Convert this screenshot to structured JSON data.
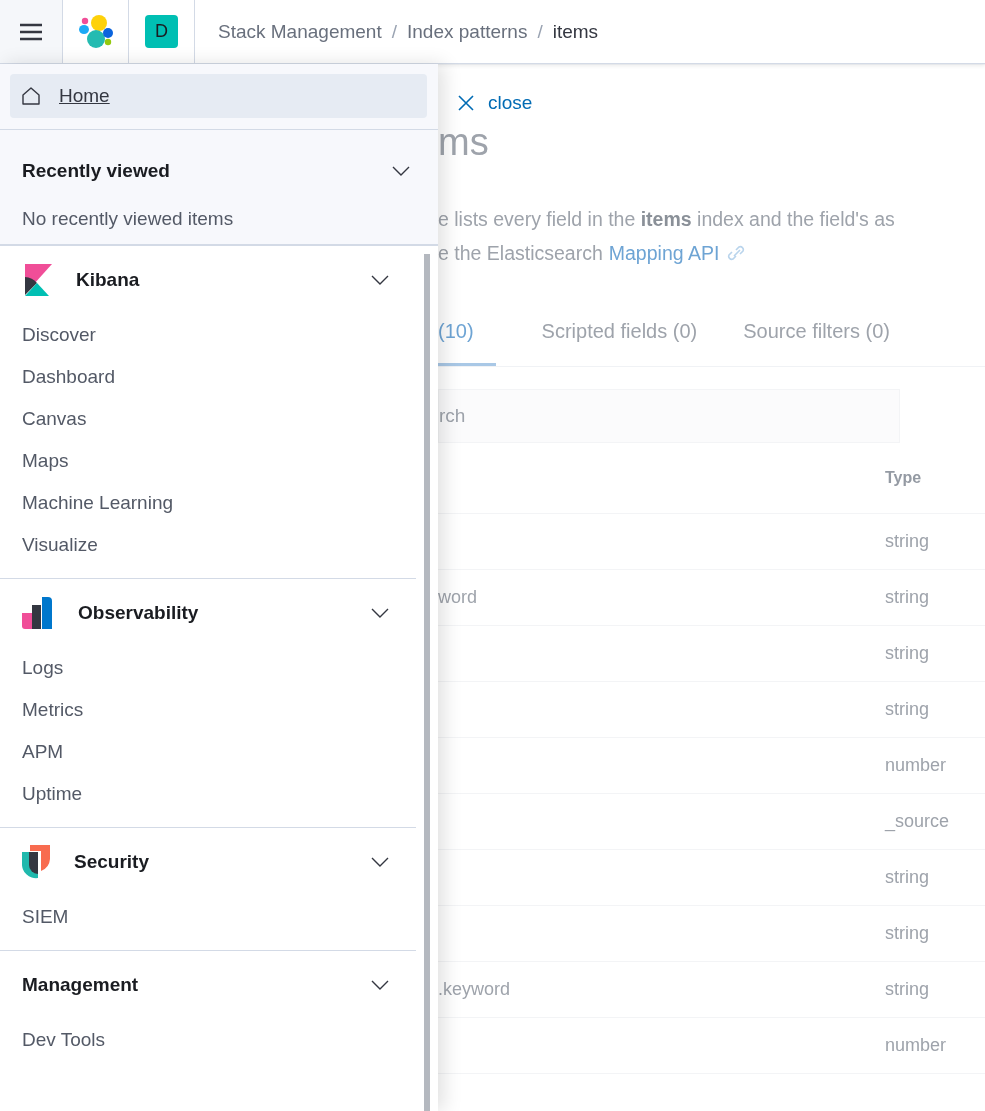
{
  "header": {
    "avatar": "D",
    "separator": "/",
    "breadcrumbs": [
      {
        "label": "Stack Management",
        "current": false
      },
      {
        "label": "Index patterns",
        "current": false
      },
      {
        "label": "items",
        "current": true
      }
    ]
  },
  "nav": {
    "home": {
      "label": "Home",
      "selected": true
    },
    "recently_viewed": {
      "title": "Recently viewed",
      "expanded": true,
      "empty_text": "No recently viewed items"
    },
    "groups": [
      {
        "title": "Kibana",
        "expanded": true,
        "items": [
          "Discover",
          "Dashboard",
          "Canvas",
          "Maps",
          "Machine Learning",
          "Visualize"
        ]
      },
      {
        "title": "Observability",
        "expanded": true,
        "items": [
          "Logs",
          "Metrics",
          "APM",
          "Uptime"
        ]
      },
      {
        "title": "Security",
        "expanded": true,
        "items": [
          "SIEM"
        ]
      },
      {
        "title": "Management",
        "expanded": true,
        "items": [
          "Dev Tools"
        ]
      }
    ]
  },
  "page": {
    "close_link": "close",
    "title": "ms",
    "description": "e lists every field in the **items** index and the field's as",
    "description_2": "e the Elasticsearch",
    "doc_link": "Mapping API",
    "tabs": [
      {
        "label": "(10)",
        "selected": true
      },
      {
        "label": "Scripted fields (0)",
        "selected": false
      },
      {
        "label": "Source filters (0)",
        "selected": false
      }
    ],
    "search": {
      "placeholder": "rch"
    },
    "table": {
      "columns": [
        "Type"
      ],
      "rows": [
        {
          "type": "string"
        },
        {
          "column_1": "word",
          "type": "string"
        },
        {
          "type": "string"
        },
        {
          "type": "string"
        },
        {
          "type": "number"
        },
        {
          "type": "_source"
        },
        {
          "type": "string"
        },
        {
          "type": "string"
        },
        {
          "column_1": ".keyword",
          "type": "string"
        },
        {
          "type": "number"
        }
      ]
    }
  }
}
